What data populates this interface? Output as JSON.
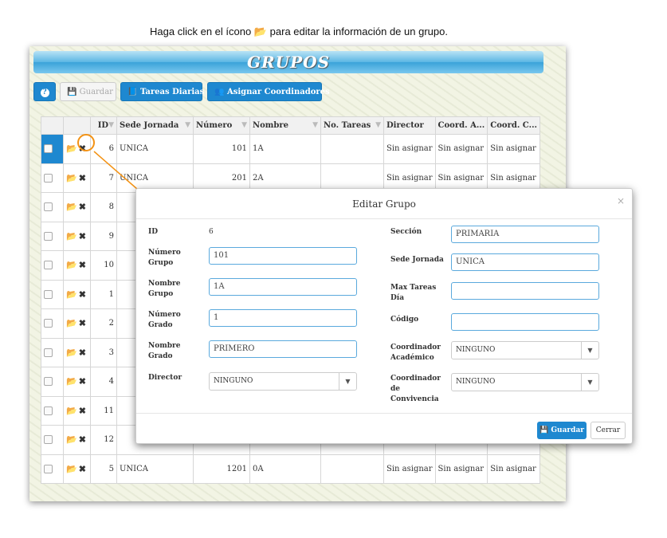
{
  "instruction": {
    "before": "Haga click en el ícono",
    "icon": "folder-open-icon",
    "after": "para editar la información de un grupo."
  },
  "app": {
    "title": "GRUPOS",
    "toolbar": {
      "help_label": "?",
      "save_label": "Guardar",
      "tareas_label": "Tareas Diarias",
      "asignar_label": "Asignar Coordinadores"
    },
    "grid": {
      "columns": [
        "ID",
        "Sede Jornada",
        "Número",
        "Nombre",
        "No. Tareas",
        "Director",
        "Coord. A...",
        "Coord. C..."
      ],
      "rows": [
        {
          "id": "6",
          "sede": "UNICA",
          "numero": "101",
          "nombre": "1A",
          "tareas": "",
          "director": "Sin asignar",
          "coordA": "Sin asignar",
          "coordC": "Sin asignar"
        },
        {
          "id": "7",
          "sede": "UNICA",
          "numero": "201",
          "nombre": "2A",
          "tareas": "",
          "director": "Sin asignar",
          "coordA": "Sin asignar",
          "coordC": "Sin asignar"
        },
        {
          "id": "8",
          "sede": "",
          "numero": "",
          "nombre": "",
          "tareas": "",
          "director": "",
          "coordA": "",
          "coordC": ""
        },
        {
          "id": "9",
          "sede": "",
          "numero": "",
          "nombre": "",
          "tareas": "",
          "director": "",
          "coordA": "",
          "coordC": ""
        },
        {
          "id": "10",
          "sede": "",
          "numero": "",
          "nombre": "",
          "tareas": "",
          "director": "",
          "coordA": "",
          "coordC": ""
        },
        {
          "id": "1",
          "sede": "",
          "numero": "",
          "nombre": "",
          "tareas": "",
          "director": "",
          "coordA": "",
          "coordC": ""
        },
        {
          "id": "2",
          "sede": "",
          "numero": "",
          "nombre": "",
          "tareas": "",
          "director": "",
          "coordA": "",
          "coordC": ""
        },
        {
          "id": "3",
          "sede": "",
          "numero": "",
          "nombre": "",
          "tareas": "",
          "director": "",
          "coordA": "",
          "coordC": ""
        },
        {
          "id": "4",
          "sede": "",
          "numero": "",
          "nombre": "",
          "tareas": "",
          "director": "",
          "coordA": "",
          "coordC": ""
        },
        {
          "id": "11",
          "sede": "",
          "numero": "",
          "nombre": "",
          "tareas": "",
          "director": "",
          "coordA": "",
          "coordC": ""
        },
        {
          "id": "12",
          "sede": "",
          "numero": "",
          "nombre": "",
          "tareas": "",
          "director": "",
          "coordA": "",
          "coordC": ""
        },
        {
          "id": "5",
          "sede": "UNICA",
          "numero": "1201",
          "nombre": "0A",
          "tareas": "",
          "director": "Sin asignar",
          "coordA": "Sin asignar",
          "coordC": "Sin asignar"
        }
      ]
    }
  },
  "modal": {
    "title": "Editar Grupo",
    "close": "×",
    "fields": {
      "id_label": "ID",
      "id_value": "6",
      "numero_grupo_label": "Número\nGrupo",
      "numero_grupo_value": "101",
      "nombre_grupo_label": "Nombre\nGrupo",
      "nombre_grupo_value": "1A",
      "numero_grado_label": "Número\nGrado",
      "numero_grado_value": "1",
      "nombre_grado_label": "Nombre\nGrado",
      "nombre_grado_value": "PRIMERO",
      "director_label": "Director",
      "director_value": "NINGUNO",
      "seccion_label": "Sección",
      "seccion_value": "PRIMARIA",
      "sede_jornada_label": "Sede Jornada",
      "sede_jornada_value": "UNICA",
      "max_tareas_label": "Max Tareas\nDía",
      "max_tareas_value": "",
      "codigo_label": "Código",
      "codigo_value": "",
      "coord_academico_label": "Coordinador\nAcadémico",
      "coord_academico_value": "NINGUNO",
      "coord_convivencia_label": "Coordinador\nde\nConvivencia",
      "coord_convivencia_value": "NINGUNO"
    },
    "save_label": "Guardar",
    "close_label": "Cerrar"
  },
  "colors": {
    "primary": "#1e88d0",
    "highlight": "#f39214"
  }
}
